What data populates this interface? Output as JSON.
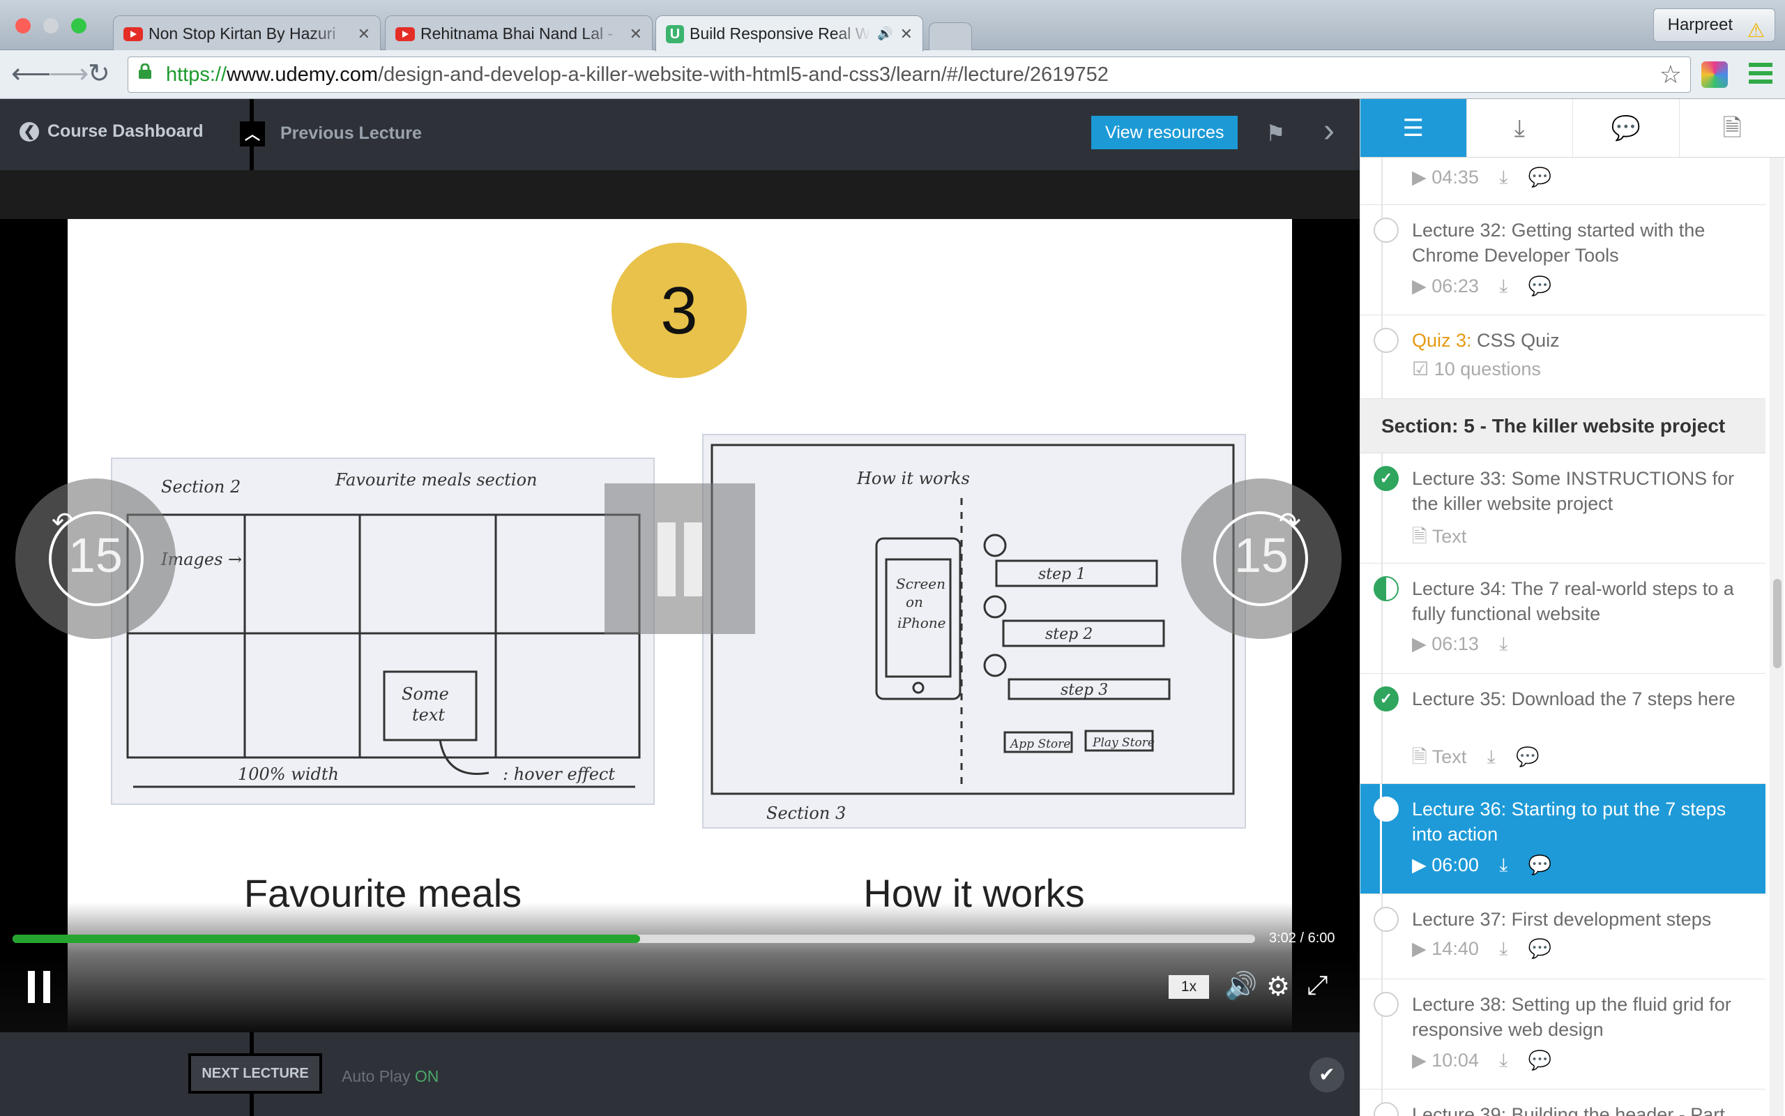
{
  "browser": {
    "tabs": [
      {
        "title": "Non Stop Kirtan By Hazuri"
      },
      {
        "title": "Rehitnama Bhai Nand Lal -"
      },
      {
        "title": "Build Responsive Real W"
      }
    ],
    "profile": "Harpreet",
    "url": {
      "scheme": "https://",
      "host": "www.udemy.com",
      "path": "/design-and-develop-a-killer-website-with-html5-and-css3/learn/#/lecture/2619752"
    }
  },
  "header": {
    "back_label": "Course Dashboard",
    "prev_label": "Previous Lecture",
    "resources_label": "View resources"
  },
  "video": {
    "slide_number": "3",
    "left_caption": "Favourite meals",
    "right_caption": "How it works",
    "skip_back": "15",
    "skip_forward": "15",
    "time": "3:02 / 6:00",
    "progress_fraction": 0.505,
    "speed": "1x"
  },
  "footer": {
    "next_label": "NEXT LECTURE",
    "autoplay_label": "Auto Play",
    "autoplay_state": "ON"
  },
  "sidebar": {
    "first_duration": "04:35",
    "items": [
      {
        "title": "Lecture 32: Getting started with the Chrome Developer Tools",
        "meta": "06:23"
      },
      {
        "quiz": "Quiz 3:",
        "title": " CSS Quiz",
        "meta": "10 questions"
      },
      {
        "title": "Lecture 33: Some INSTRUCTIONS for the killer website project",
        "meta": "Text"
      },
      {
        "title": "Lecture 34: The 7 real-world steps to a fully functional website",
        "meta": "06:13"
      },
      {
        "title": "Lecture 35: Download the 7 steps here",
        "meta": "Text"
      },
      {
        "title": "Lecture 36: Starting to put the 7 steps into action",
        "meta": "06:00"
      },
      {
        "title": "Lecture 37: First development steps",
        "meta": "14:40"
      },
      {
        "title": "Lecture 38: Setting up the fluid grid for responsive web design",
        "meta": "10:04"
      },
      {
        "title": "Lecture 39: Building the header - Part"
      }
    ],
    "section_title": "Section: 5 - The killer website project"
  },
  "colors": {
    "accent": "#1e9ad8",
    "progress": "#25a52f",
    "complete": "#2fa55e",
    "quiz": "#e49a12"
  }
}
